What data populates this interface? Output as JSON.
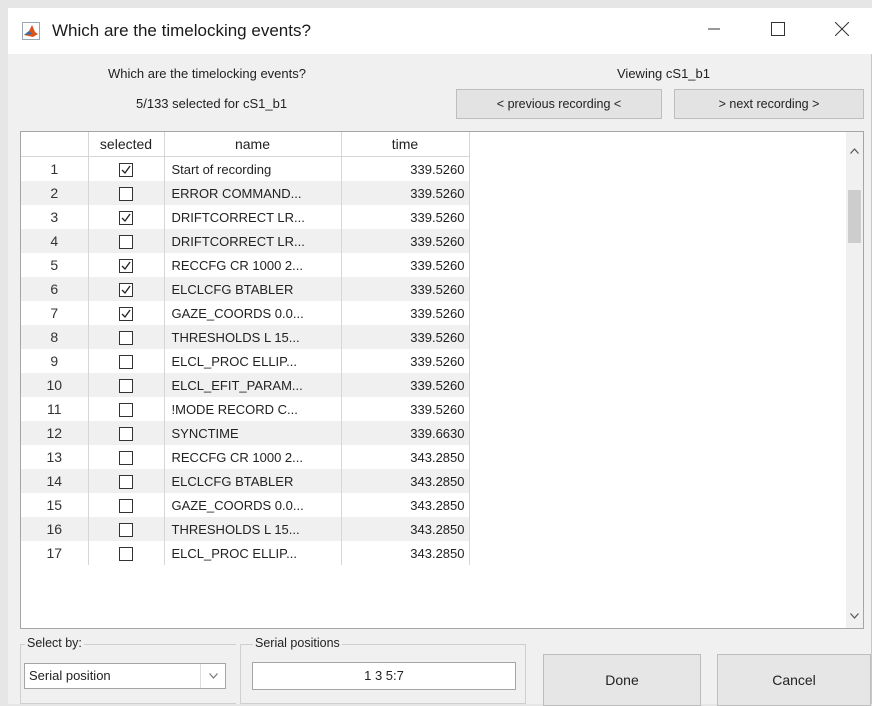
{
  "window": {
    "title": "Which are the timelocking events?",
    "icons": {
      "app": "matlab-icon",
      "minimize": "minimize-icon",
      "maximize": "maximize-icon",
      "close": "close-icon"
    }
  },
  "header": {
    "question": "Which are the timelocking events?",
    "selected_count": "5/133 selected for cS1_b1",
    "viewing": "Viewing cS1_b1",
    "prev_label": "< previous recording <",
    "next_label": "> next recording >"
  },
  "table": {
    "columns": [
      "",
      "selected",
      "name",
      "time"
    ],
    "rows": [
      {
        "num": "1",
        "selected": true,
        "name": "Start of recording",
        "time": "339.5260"
      },
      {
        "num": "2",
        "selected": false,
        "name": "ERROR COMMAND...",
        "time": "339.5260"
      },
      {
        "num": "3",
        "selected": true,
        "name": "DRIFTCORRECT LR...",
        "time": "339.5260"
      },
      {
        "num": "4",
        "selected": false,
        "name": "DRIFTCORRECT LR...",
        "time": "339.5260"
      },
      {
        "num": "5",
        "selected": true,
        "name": "RECCFG CR 1000 2...",
        "time": "339.5260"
      },
      {
        "num": "6",
        "selected": true,
        "name": "ELCLCFG BTABLER",
        "time": "339.5260"
      },
      {
        "num": "7",
        "selected": true,
        "name": "GAZE_COORDS 0.0...",
        "time": "339.5260"
      },
      {
        "num": "8",
        "selected": false,
        "name": "THRESHOLDS L 15...",
        "time": "339.5260"
      },
      {
        "num": "9",
        "selected": false,
        "name": "ELCL_PROC ELLIP...",
        "time": "339.5260"
      },
      {
        "num": "10",
        "selected": false,
        "name": "ELCL_EFIT_PARAM...",
        "time": "339.5260"
      },
      {
        "num": "11",
        "selected": false,
        "name": "!MODE RECORD C...",
        "time": "339.5260"
      },
      {
        "num": "12",
        "selected": false,
        "name": "SYNCTIME",
        "time": "339.6630"
      },
      {
        "num": "13",
        "selected": false,
        "name": "RECCFG CR 1000 2...",
        "time": "343.2850"
      },
      {
        "num": "14",
        "selected": false,
        "name": "ELCLCFG BTABLER",
        "time": "343.2850"
      },
      {
        "num": "15",
        "selected": false,
        "name": "GAZE_COORDS 0.0...",
        "time": "343.2850"
      },
      {
        "num": "16",
        "selected": false,
        "name": "THRESHOLDS L 15...",
        "time": "343.2850"
      },
      {
        "num": "17",
        "selected": false,
        "name": "ELCL_PROC ELLIP...",
        "time": "343.2850"
      }
    ]
  },
  "footer": {
    "select_by_label": "Select by:",
    "select_by_value": "Serial position",
    "serial_label": "Serial positions",
    "serial_value": "1 3 5:7",
    "done_label": "Done",
    "cancel_label": "Cancel"
  }
}
